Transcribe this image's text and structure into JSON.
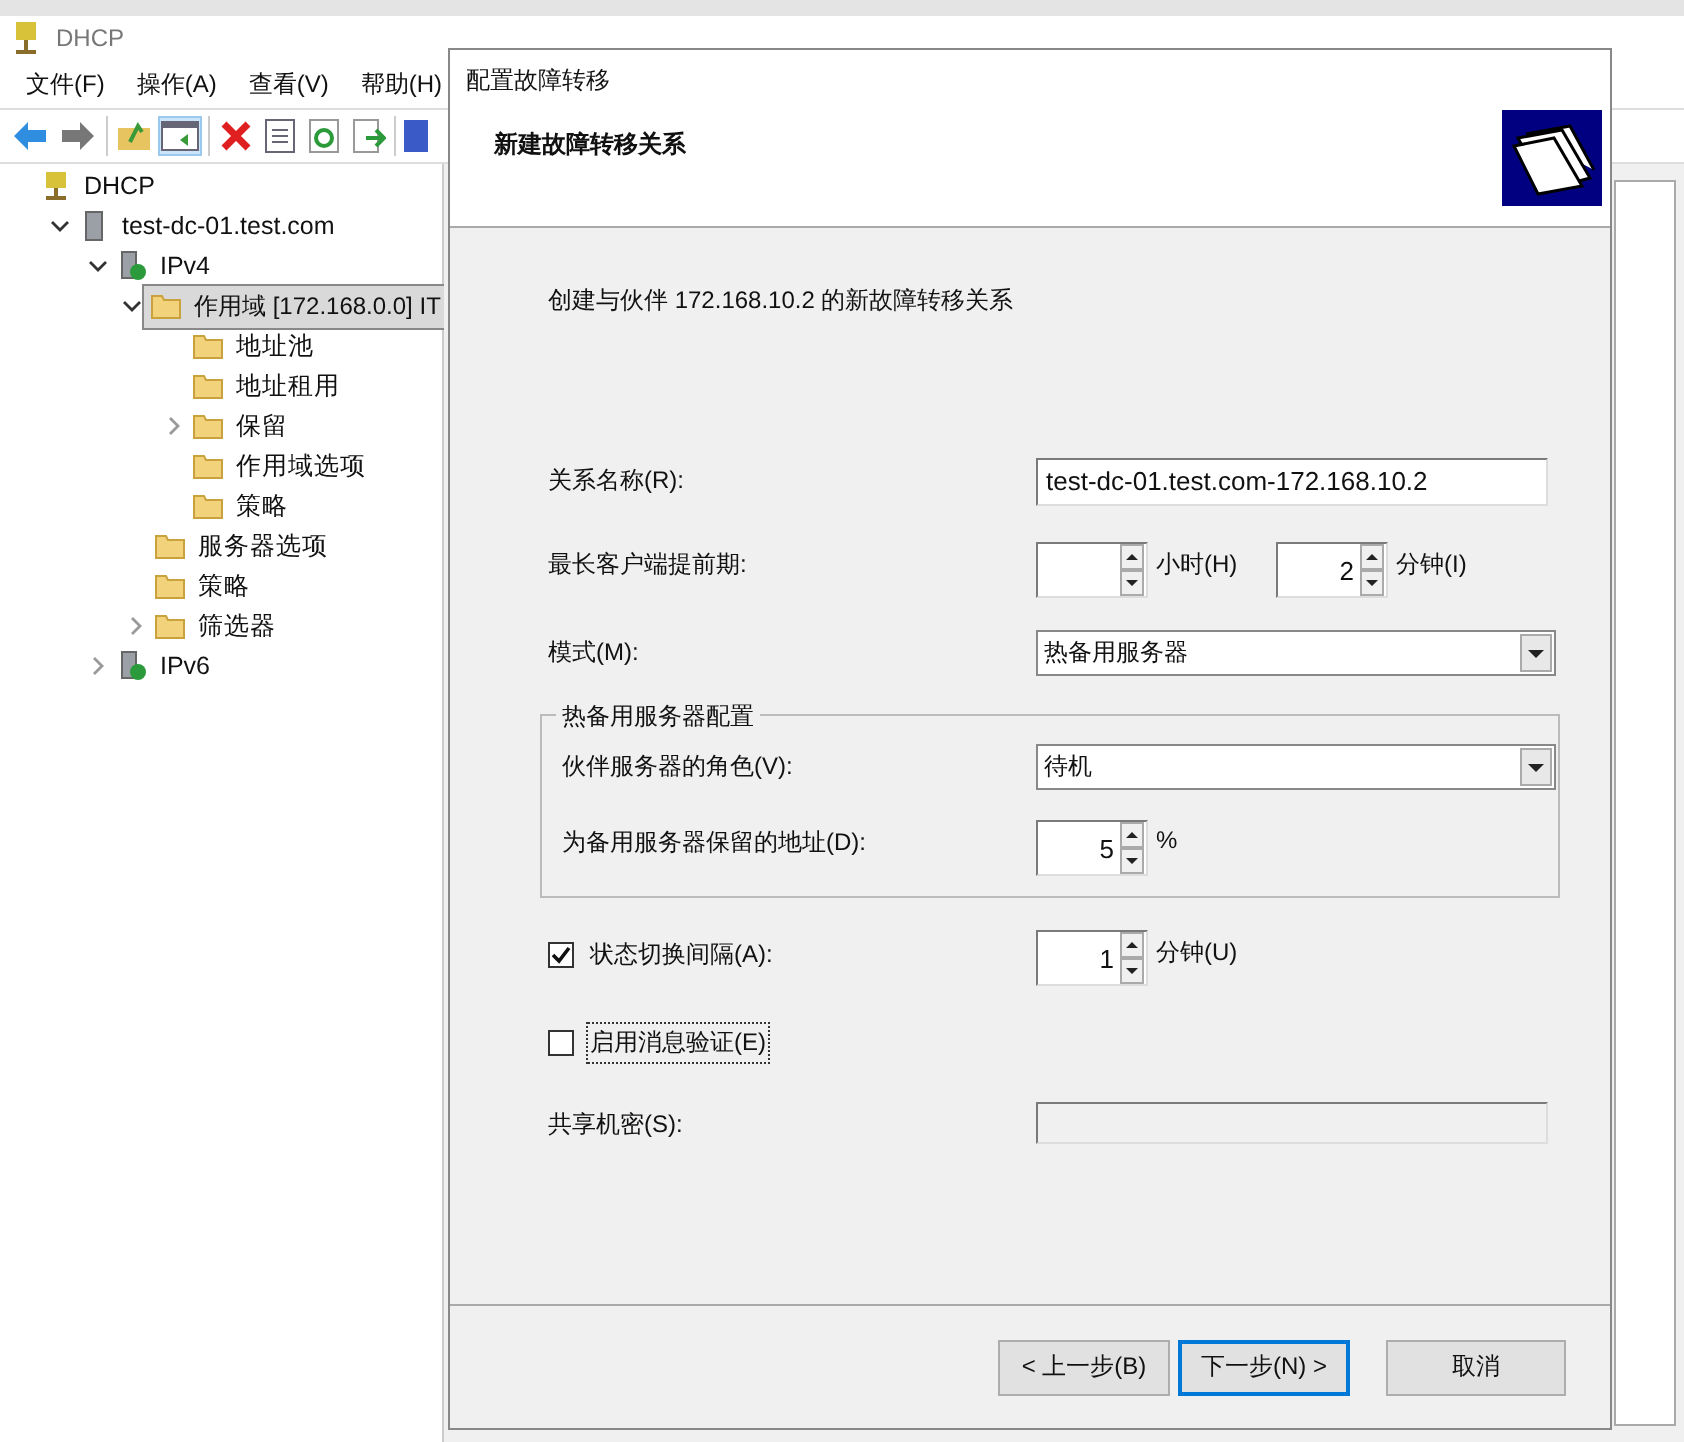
{
  "window": {
    "title": "DHCP"
  },
  "menu": [
    "文件(F)",
    "操作(A)",
    "查看(V)",
    "帮助(H)"
  ],
  "tree": [
    {
      "label": "DHCP",
      "kind": "dhcp",
      "selected": false,
      "children": [
        {
          "label": "test-dc-01.test.com",
          "kind": "server",
          "selected": false,
          "expanded": true,
          "children": [
            {
              "label": "IPv4",
              "kind": "protocol",
              "selected": false,
              "expanded": true,
              "children": [
                {
                  "label": "作用域 [172.168.0.0] IT",
                  "kind": "folder",
                  "selected": true,
                  "expanded": true,
                  "children": [
                    {
                      "label": "地址池",
                      "kind": "folder",
                      "selected": false
                    },
                    {
                      "label": "地址租用",
                      "kind": "folder",
                      "selected": false
                    },
                    {
                      "label": "保留",
                      "kind": "folder",
                      "selected": false,
                      "expanded": false
                    },
                    {
                      "label": "作用域选项",
                      "kind": "folder",
                      "selected": false
                    },
                    {
                      "label": "策略",
                      "kind": "folder",
                      "selected": false
                    }
                  ]
                },
                {
                  "label": "服务器选项",
                  "kind": "folder",
                  "selected": false
                },
                {
                  "label": "策略",
                  "kind": "folder",
                  "selected": false
                },
                {
                  "label": "筛选器",
                  "kind": "folder",
                  "selected": false,
                  "expanded": false
                }
              ]
            },
            {
              "label": "IPv6",
              "kind": "protocol",
              "selected": false,
              "expanded": false
            }
          ]
        }
      ]
    }
  ],
  "dialog": {
    "title": "配置故障转移",
    "heading": "新建故障转移关系",
    "description": "创建与伙伴 172.168.10.2 的新故障转移关系",
    "fields": [
      {
        "kind": "text",
        "label": "关系名称(R):",
        "value": "test-dc-01.test.com-172.168.10.2",
        "disabled": false
      },
      {
        "kind": "spins",
        "label": "最长客户端提前期:",
        "spins": [
          {
            "unit": "小时(H)"
          },
          {
            "value": "2",
            "unit": "分钟(I)"
          }
        ]
      },
      {
        "kind": "select",
        "label": "模式(M):",
        "value": "热备用服务器"
      },
      {
        "kind": "group",
        "title": "热备用服务器配置",
        "fields": [
          {
            "kind": "select",
            "label": "伙伴服务器的角色(V):",
            "value": "待机"
          },
          {
            "kind": "spins",
            "label": "为备用服务器保留的地址(D):",
            "spins": [
              {
                "value": "5",
                "unit": "%"
              }
            ]
          }
        ]
      },
      {
        "kind": "check",
        "label": "状态切换间隔(A):",
        "checked": true,
        "focused": false,
        "spins": [
          {
            "value": "1",
            "unit": "分钟(U)"
          }
        ]
      },
      {
        "kind": "check",
        "label": "启用消息验证(E)",
        "checked": false,
        "focused": true
      },
      {
        "kind": "text",
        "label": "共享机密(S):",
        "disabled": true
      }
    ],
    "buttons": [
      {
        "label": "< 上一步(B)",
        "default": false
      },
      {
        "label": "下一步(N) >",
        "default": true
      },
      {
        "label": "取消",
        "default": false
      }
    ]
  }
}
